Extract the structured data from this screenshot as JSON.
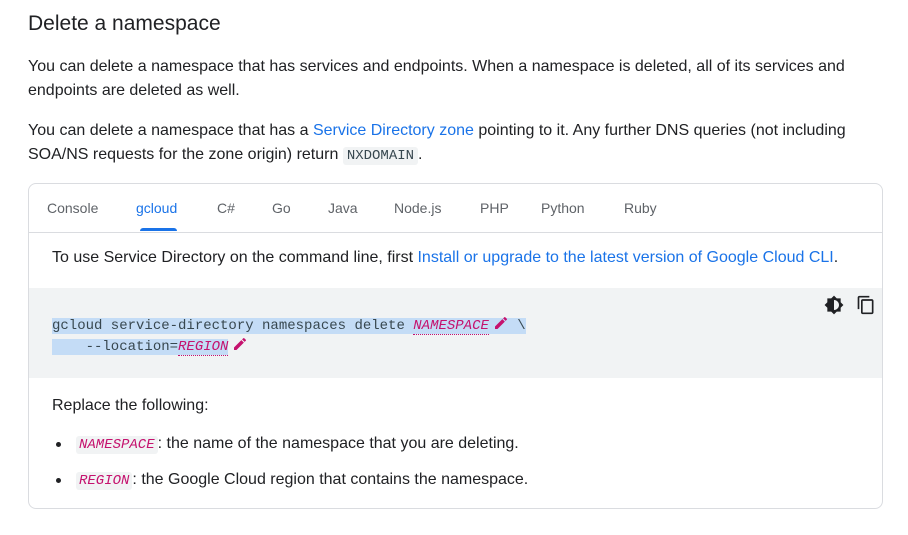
{
  "heading": "Delete a namespace",
  "paragraph1": "You can delete a namespace that has services and endpoints. When a namespace is deleted, all of its services and endpoints are deleted as well.",
  "paragraph2": {
    "before": "You can delete a namespace that has a ",
    "link": "Service Directory zone",
    "after": " pointing to it. Any further DNS queries (not including SOA/NS requests for the zone origin) return ",
    "code": "NXDOMAIN",
    "end": "."
  },
  "tabs": [
    "Console",
    "gcloud",
    "C#",
    "Go",
    "Java",
    "Node.js",
    "PHP",
    "Python",
    "Ruby"
  ],
  "active_tab": "gcloud",
  "intro": {
    "before": "To use Service Directory on the command line, first ",
    "link": "Install or upgrade to the latest version of Google Cloud CLI",
    "after": "."
  },
  "code": {
    "line1_prefix": "gcloud service-directory namespaces delete ",
    "line1_var": "NAMESPACE",
    "line1_suffix": " \\",
    "line2_prefix": "    --location=",
    "line2_var": "REGION"
  },
  "replace_heading": "Replace the following:",
  "replacements": [
    {
      "var": "NAMESPACE",
      "desc": ": the name of the namespace that you are deleting."
    },
    {
      "var": "REGION",
      "desc": ": the Google Cloud region that contains the namespace."
    }
  ],
  "colors": {
    "link": "#1a73e8",
    "var": "#c5126e",
    "selection": "#c4dcf6"
  }
}
